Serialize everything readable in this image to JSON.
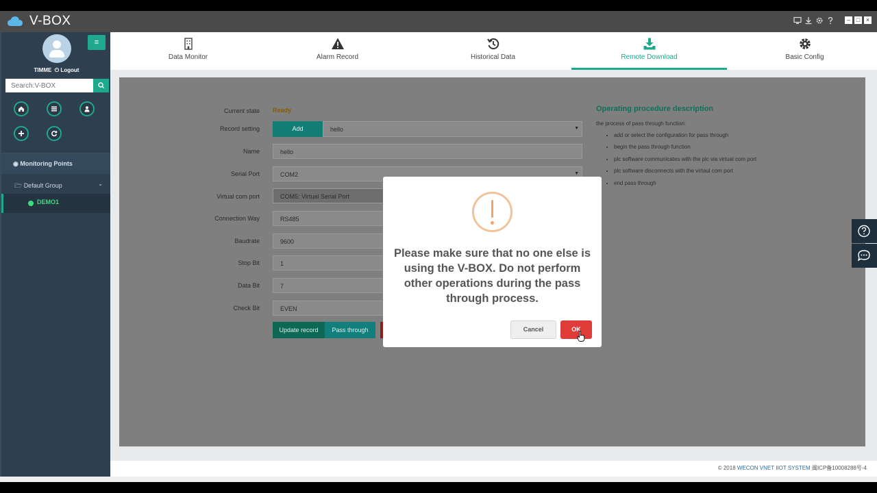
{
  "titlebar": {
    "app_title": "V-BOX"
  },
  "sidebar": {
    "user_name": "TIMME",
    "logout_label": "Logout",
    "search_placeholder": "Search:V-BOX",
    "monitoring_points_label": "Monitoring Points",
    "group_label": "Default Group",
    "device_label": "DEMO1"
  },
  "tabs": [
    {
      "label": "Data Monitor",
      "icon": "building-icon"
    },
    {
      "label": "Alarm Record",
      "icon": "warning-icon"
    },
    {
      "label": "Historical Data",
      "icon": "history-icon"
    },
    {
      "label": "Remote Download",
      "icon": "download-icon",
      "active": true
    },
    {
      "label": "Basic Config",
      "icon": "gear-icon"
    }
  ],
  "form": {
    "current_state_label": "Current state",
    "current_state_value": "Ready",
    "record_setting_label": "Record setting",
    "add_button": "Add",
    "record_value": "hello",
    "name_label": "Name",
    "name_value": "hello",
    "serial_port_label": "Serial Port",
    "serial_port_value": "COM2",
    "virtual_com_label": "Virtual com port",
    "virtual_com_value": "COM5: Virtual Serial Port",
    "connection_way_label": "Connection Way",
    "connection_way_value": "RS485",
    "baudrate_label": "Baudrate",
    "baudrate_value": "9600",
    "stop_bit_label": "Stop Bit",
    "stop_bit_value": "1",
    "data_bit_label": "Data Bit",
    "data_bit_value": "7",
    "check_bit_label": "Check Bit",
    "check_bit_value": "EVEN",
    "update_record_button": "Update record",
    "pass_through_button": "Pass through"
  },
  "procedure": {
    "title": "Operating procedure description",
    "intro": "the process of pass through function:",
    "steps": [
      "add or select the configuration for pass through",
      "begin the pass through function",
      "plc software communicates with the plc via virtual com port",
      "plc software disconnects with the virtaul com port",
      "end pass through"
    ]
  },
  "modal": {
    "message": "Please make sure that no one else is using the V-BOX. Do not perform other operations during the pass through process.",
    "cancel_label": "Cancel",
    "ok_label": "OK"
  },
  "footer": {
    "copyright": "© 2018",
    "link_text": "WECON VNET IIOT SYSTEM",
    "icp": "闽ICP备10008288号-4"
  },
  "colors": {
    "accent": "#1fa98c",
    "danger": "#df3b39",
    "sidebar_bg": "#2e3f4f"
  }
}
